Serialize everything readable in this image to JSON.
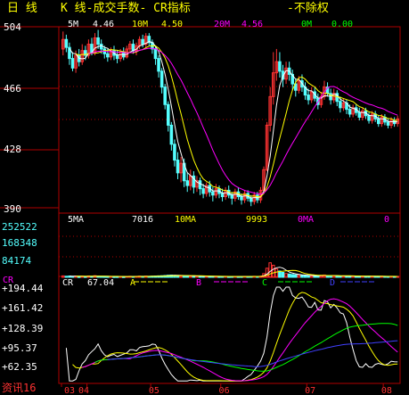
{
  "header": {
    "period": "日  线",
    "title": "K  线-成交手数- CR指标",
    "adjust": "-不除权"
  },
  "price_panel": {
    "ma_legend": [
      {
        "label": "5M",
        "value": "4.46",
        "color": "#ffffff"
      },
      {
        "label": "10M",
        "value": "4.50",
        "color": "#ffff00"
      },
      {
        "label": "20M",
        "value": "4.56",
        "color": "#ff00ff"
      },
      {
        "label": "0M",
        "value": "0.00",
        "color": "#00ff00"
      }
    ],
    "axis_labels": [
      "504",
      "466",
      "428",
      "390"
    ]
  },
  "volume_panel": {
    "legend": [
      {
        "label": "5MA",
        "value": "7016",
        "color": "#ffffff"
      },
      {
        "label": "10MA",
        "value": "9993",
        "color": "#ffff00"
      },
      {
        "label": "0MA",
        "value": "0",
        "color": "#ff00ff"
      }
    ],
    "axis_labels": [
      "252522",
      "168348",
      "84174"
    ]
  },
  "cr_panel": {
    "title": "CR",
    "legend_name": "CR",
    "legend_value": "67.04",
    "legend_letters": [
      "A",
      "B",
      "C",
      "D"
    ],
    "axis_labels": [
      "+194.44",
      "+161.42",
      "+128.39",
      "+95.37",
      "+62.35"
    ]
  },
  "x_axis": {
    "labels": [
      "03",
      "04",
      "05",
      "06",
      "07",
      "08"
    ]
  },
  "footer": {
    "brand": "资讯16"
  },
  "colors": {
    "up": "#ff3232",
    "down": "#54ffff",
    "grid": "#b00000",
    "axis_text": "#ffffff",
    "cr_axis_text": "#ffffff",
    "ma5": "#ffffff",
    "ma10": "#ffff00",
    "ma20": "#ff00ff",
    "cr_ma_a": "#ffff00",
    "cr_ma_b": "#ff00ff",
    "cr_ma_c": "#00ff00",
    "cr_ma_d": "#4040ff"
  },
  "chart_data": {
    "type": "candlestick",
    "price_range": [
      3.9,
      5.04
    ],
    "volume_range": [
      0,
      336696
    ],
    "cr_range": [
      30,
      227
    ],
    "month_starts": [
      0,
      8,
      28,
      50,
      77,
      101
    ],
    "candles": [
      [
        4.9,
        4.96,
        5.01,
        4.86,
        8200
      ],
      [
        4.96,
        4.91,
        4.99,
        4.88,
        6100
      ],
      [
        4.91,
        4.84,
        4.94,
        4.8,
        7400
      ],
      [
        4.84,
        4.78,
        4.88,
        4.76,
        5200
      ],
      [
        4.78,
        4.86,
        4.89,
        4.75,
        6800
      ],
      [
        4.86,
        4.82,
        4.9,
        4.79,
        4100
      ],
      [
        4.82,
        4.89,
        4.93,
        4.8,
        5900
      ],
      [
        4.89,
        4.86,
        4.92,
        4.83,
        4400
      ],
      [
        4.86,
        4.93,
        4.96,
        4.84,
        7700
      ],
      [
        4.93,
        4.88,
        4.97,
        4.86,
        5600
      ],
      [
        4.88,
        4.97,
        5.0,
        4.86,
        9300
      ],
      [
        4.97,
        4.93,
        5.02,
        4.9,
        6200
      ],
      [
        4.93,
        4.9,
        4.96,
        4.87,
        5000
      ],
      [
        4.9,
        4.87,
        4.92,
        4.84,
        4600
      ],
      [
        4.87,
        4.85,
        4.9,
        4.82,
        4300
      ],
      [
        4.85,
        4.89,
        4.91,
        4.83,
        4800
      ],
      [
        4.89,
        4.86,
        4.92,
        4.83,
        3900
      ],
      [
        4.86,
        4.84,
        4.89,
        4.81,
        4200
      ],
      [
        4.84,
        4.88,
        4.9,
        4.82,
        4500
      ],
      [
        4.88,
        4.85,
        4.91,
        4.83,
        3700
      ],
      [
        4.85,
        4.9,
        4.92,
        4.84,
        5100
      ],
      [
        4.9,
        4.93,
        4.95,
        4.88,
        5800
      ],
      [
        4.93,
        4.89,
        4.96,
        4.87,
        4900
      ],
      [
        4.89,
        4.92,
        4.94,
        4.86,
        5300
      ],
      [
        4.92,
        4.96,
        4.98,
        4.9,
        6400
      ],
      [
        4.96,
        4.93,
        4.99,
        4.91,
        5200
      ],
      [
        4.93,
        4.98,
        5.0,
        4.91,
        6900
      ],
      [
        4.98,
        4.94,
        5.0,
        4.92,
        5500
      ],
      [
        4.94,
        4.9,
        4.96,
        4.87,
        6100
      ],
      [
        4.9,
        4.84,
        4.92,
        4.8,
        7200
      ],
      [
        4.84,
        4.76,
        4.86,
        4.72,
        8300
      ],
      [
        4.76,
        4.66,
        4.78,
        4.62,
        9100
      ],
      [
        4.66,
        4.55,
        4.68,
        4.52,
        10200
      ],
      [
        4.55,
        4.42,
        4.57,
        4.38,
        11800
      ],
      [
        4.42,
        4.3,
        4.44,
        4.26,
        12600
      ],
      [
        4.3,
        4.2,
        4.33,
        4.16,
        11400
      ],
      [
        4.2,
        4.12,
        4.25,
        4.08,
        10100
      ],
      [
        4.12,
        4.18,
        4.22,
        4.06,
        8700
      ],
      [
        4.18,
        4.07,
        4.21,
        4.03,
        9400
      ],
      [
        4.07,
        4.04,
        4.12,
        4.0,
        7800
      ],
      [
        4.04,
        4.1,
        4.14,
        4.01,
        6900
      ],
      [
        4.1,
        4.03,
        4.13,
        3.99,
        7500
      ],
      [
        4.03,
        4.07,
        4.1,
        4.0,
        6300
      ],
      [
        4.07,
        4.02,
        4.09,
        3.98,
        6800
      ],
      [
        4.02,
        3.99,
        4.05,
        3.96,
        5900
      ],
      [
        3.99,
        4.04,
        4.06,
        3.97,
        6600
      ],
      [
        4.04,
        4.0,
        4.07,
        3.97,
        5400
      ],
      [
        4.0,
        3.98,
        4.03,
        3.94,
        5100
      ],
      [
        3.98,
        4.02,
        4.05,
        3.96,
        4700
      ],
      [
        4.02,
        3.99,
        4.04,
        3.96,
        4500
      ],
      [
        3.99,
        3.97,
        4.02,
        3.94,
        4900
      ],
      [
        3.97,
        4.01,
        4.03,
        3.95,
        5200
      ],
      [
        4.01,
        3.98,
        4.04,
        3.96,
        4300
      ],
      [
        3.98,
        3.96,
        4.0,
        3.92,
        4800
      ],
      [
        3.96,
        4.0,
        4.02,
        3.94,
        5000
      ],
      [
        4.0,
        3.97,
        4.03,
        3.95,
        4400
      ],
      [
        3.97,
        3.95,
        3.99,
        3.92,
        4600
      ],
      [
        3.95,
        3.99,
        4.01,
        3.93,
        5300
      ],
      [
        3.99,
        3.96,
        4.01,
        3.94,
        4700
      ],
      [
        3.96,
        3.94,
        3.98,
        3.91,
        5100
      ],
      [
        3.94,
        3.98,
        4.0,
        3.92,
        5800
      ],
      [
        3.98,
        3.95,
        4.0,
        3.93,
        4900
      ],
      [
        3.95,
        4.01,
        4.03,
        3.93,
        6200
      ],
      [
        4.01,
        4.14,
        4.16,
        4.0,
        21000
      ],
      [
        4.14,
        4.42,
        4.44,
        4.13,
        52000
      ],
      [
        4.42,
        4.6,
        4.66,
        4.38,
        83000
      ],
      [
        4.6,
        4.75,
        4.88,
        4.55,
        69000
      ],
      [
        4.75,
        4.82,
        4.9,
        4.7,
        48000
      ],
      [
        4.82,
        4.76,
        4.88,
        4.72,
        36000
      ],
      [
        4.76,
        4.71,
        4.8,
        4.66,
        28000
      ],
      [
        4.71,
        4.78,
        4.82,
        4.68,
        22000
      ],
      [
        4.78,
        4.74,
        4.82,
        4.7,
        19000
      ],
      [
        4.74,
        4.68,
        4.77,
        4.64,
        16000
      ],
      [
        4.68,
        4.64,
        4.71,
        4.6,
        14000
      ],
      [
        4.64,
        4.7,
        4.73,
        4.62,
        12000
      ],
      [
        4.7,
        4.66,
        4.74,
        4.63,
        11000
      ],
      [
        4.66,
        4.61,
        4.69,
        4.58,
        10500
      ],
      [
        4.61,
        4.58,
        4.65,
        4.55,
        9800
      ],
      [
        4.58,
        4.63,
        4.66,
        4.56,
        9200
      ],
      [
        4.63,
        4.59,
        4.66,
        4.57,
        8600
      ],
      [
        4.59,
        4.55,
        4.62,
        4.52,
        9400
      ],
      [
        4.55,
        4.6,
        4.63,
        4.53,
        10800
      ],
      [
        4.6,
        4.66,
        4.7,
        4.58,
        13200
      ],
      [
        4.66,
        4.62,
        4.69,
        4.6,
        9900
      ],
      [
        4.62,
        4.58,
        4.65,
        4.55,
        8700
      ],
      [
        4.58,
        4.62,
        4.65,
        4.56,
        8200
      ],
      [
        4.62,
        4.57,
        4.64,
        4.54,
        7600
      ],
      [
        4.57,
        4.53,
        4.6,
        4.5,
        7100
      ],
      [
        4.53,
        4.56,
        4.59,
        4.51,
        6900
      ],
      [
        4.56,
        4.52,
        4.58,
        4.49,
        6400
      ],
      [
        4.52,
        4.49,
        4.55,
        4.47,
        6800
      ],
      [
        4.49,
        4.53,
        4.55,
        4.47,
        7300
      ],
      [
        4.53,
        4.5,
        4.55,
        4.48,
        5900
      ],
      [
        4.5,
        4.47,
        4.53,
        4.45,
        6200
      ],
      [
        4.47,
        4.51,
        4.53,
        4.45,
        6600
      ],
      [
        4.51,
        4.48,
        4.53,
        4.46,
        5700
      ],
      [
        4.48,
        4.45,
        4.5,
        4.43,
        6100
      ],
      [
        4.45,
        4.49,
        4.51,
        4.43,
        5800
      ],
      [
        4.49,
        4.46,
        4.51,
        4.44,
        5200
      ],
      [
        4.46,
        4.43,
        4.48,
        4.41,
        5600
      ],
      [
        4.43,
        4.47,
        4.49,
        4.41,
        5900
      ],
      [
        4.47,
        4.44,
        4.49,
        4.42,
        5100
      ],
      [
        4.44,
        4.42,
        4.46,
        4.4,
        4800
      ],
      [
        4.42,
        4.45,
        4.47,
        4.4,
        5300
      ],
      [
        4.45,
        4.43,
        4.47,
        4.41,
        4700
      ],
      [
        4.43,
        4.46,
        4.48,
        4.41,
        5000
      ]
    ]
  }
}
